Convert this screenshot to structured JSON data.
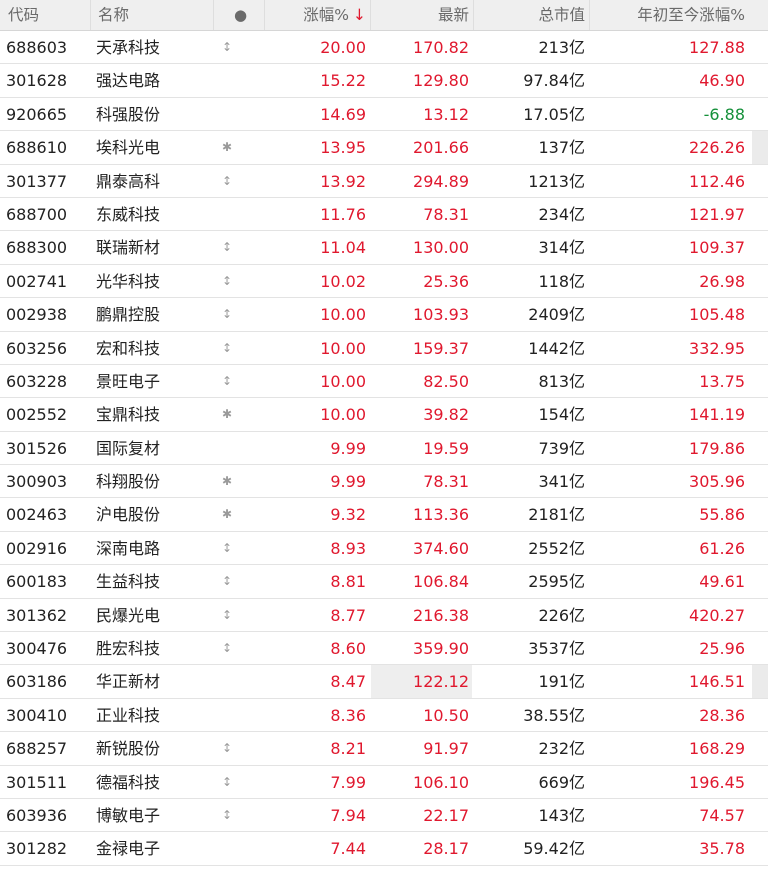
{
  "header": {
    "code": "代码",
    "name": "名称",
    "dot": "●",
    "change": "涨幅%",
    "sort_arrow": "↓",
    "last": "最新",
    "market_cap": "总市值",
    "ytd": "年初至今涨幅%"
  },
  "colors": {
    "up": "#e0182e",
    "down": "#15903a"
  },
  "rows": [
    {
      "code": "688603",
      "name": "天承科技",
      "flag": "↕",
      "change": "20.00",
      "last": "170.82",
      "cap": "213亿",
      "ytd": "127.88"
    },
    {
      "code": "301628",
      "name": "强达电路",
      "flag": "",
      "change": "15.22",
      "last": "129.80",
      "cap": "97.84亿",
      "ytd": "46.90"
    },
    {
      "code": "920665",
      "name": "科强股份",
      "flag": "",
      "change": "14.69",
      "last": "13.12",
      "cap": "17.05亿",
      "ytd": "-6.88"
    },
    {
      "code": "688610",
      "name": "埃科光电",
      "flag": "✱",
      "change": "13.95",
      "last": "201.66",
      "cap": "137亿",
      "ytd": "226.26"
    },
    {
      "code": "301377",
      "name": "鼎泰高科",
      "flag": "↕",
      "change": "13.92",
      "last": "294.89",
      "cap": "1213亿",
      "ytd": "112.46"
    },
    {
      "code": "688700",
      "name": "东威科技",
      "flag": "",
      "change": "11.76",
      "last": "78.31",
      "cap": "234亿",
      "ytd": "121.97"
    },
    {
      "code": "688300",
      "name": "联瑞新材",
      "flag": "↕",
      "change": "11.04",
      "last": "130.00",
      "cap": "314亿",
      "ytd": "109.37"
    },
    {
      "code": "002741",
      "name": "光华科技",
      "flag": "↕",
      "change": "10.02",
      "last": "25.36",
      "cap": "118亿",
      "ytd": "26.98"
    },
    {
      "code": "002938",
      "name": "鹏鼎控股",
      "flag": "↕",
      "change": "10.00",
      "last": "103.93",
      "cap": "2409亿",
      "ytd": "105.48"
    },
    {
      "code": "603256",
      "name": "宏和科技",
      "flag": "↕",
      "change": "10.00",
      "last": "159.37",
      "cap": "1442亿",
      "ytd": "332.95"
    },
    {
      "code": "603228",
      "name": "景旺电子",
      "flag": "↕",
      "change": "10.00",
      "last": "82.50",
      "cap": "813亿",
      "ytd": "13.75"
    },
    {
      "code": "002552",
      "name": "宝鼎科技",
      "flag": "✱",
      "change": "10.00",
      "last": "39.82",
      "cap": "154亿",
      "ytd": "141.19"
    },
    {
      "code": "301526",
      "name": "国际复材",
      "flag": "",
      "change": "9.99",
      "last": "19.59",
      "cap": "739亿",
      "ytd": "179.86"
    },
    {
      "code": "300903",
      "name": "科翔股份",
      "flag": "✱",
      "change": "9.99",
      "last": "78.31",
      "cap": "341亿",
      "ytd": "305.96"
    },
    {
      "code": "002463",
      "name": "沪电股份",
      "flag": "✱",
      "change": "9.32",
      "last": "113.36",
      "cap": "2181亿",
      "ytd": "55.86"
    },
    {
      "code": "002916",
      "name": "深南电路",
      "flag": "↕",
      "change": "8.93",
      "last": "374.60",
      "cap": "2552亿",
      "ytd": "61.26"
    },
    {
      "code": "600183",
      "name": "生益科技",
      "flag": "↕",
      "change": "8.81",
      "last": "106.84",
      "cap": "2595亿",
      "ytd": "49.61"
    },
    {
      "code": "301362",
      "name": "民爆光电",
      "flag": "↕",
      "change": "8.77",
      "last": "216.38",
      "cap": "226亿",
      "ytd": "420.27"
    },
    {
      "code": "300476",
      "name": "胜宏科技",
      "flag": "↕",
      "change": "8.60",
      "last": "359.90",
      "cap": "3537亿",
      "ytd": "25.96"
    },
    {
      "code": "603186",
      "name": "华正新材",
      "flag": "",
      "change": "8.47",
      "last": "122.12",
      "cap": "191亿",
      "ytd": "146.51"
    },
    {
      "code": "300410",
      "name": "正业科技",
      "flag": "",
      "change": "8.36",
      "last": "10.50",
      "cap": "38.55亿",
      "ytd": "28.36"
    },
    {
      "code": "688257",
      "name": "新锐股份",
      "flag": "↕",
      "change": "8.21",
      "last": "91.97",
      "cap": "232亿",
      "ytd": "168.29"
    },
    {
      "code": "301511",
      "name": "德福科技",
      "flag": "↕",
      "change": "7.99",
      "last": "106.10",
      "cap": "669亿",
      "ytd": "196.45"
    },
    {
      "code": "603936",
      "name": "博敏电子",
      "flag": "↕",
      "change": "7.94",
      "last": "22.17",
      "cap": "143亿",
      "ytd": "74.57"
    },
    {
      "code": "301282",
      "name": "金禄电子",
      "flag": "",
      "change": "7.44",
      "last": "28.17",
      "cap": "59.42亿",
      "ytd": "35.78"
    }
  ]
}
